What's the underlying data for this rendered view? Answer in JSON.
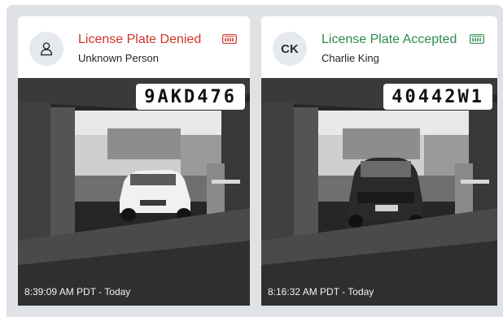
{
  "colors": {
    "denied": "#d0342c",
    "accepted": "#2e8b4e",
    "frame_background": "#dfe2e6",
    "avatar_background": "#e6e9ed"
  },
  "events": [
    {
      "status": "License Plate Denied",
      "status_type": "denied",
      "person": "Unknown Person",
      "avatar_icon": "person-outline-icon",
      "plate_icon": "license-plate-icon",
      "plate_number": "9AKD476",
      "timestamp": "8:39:09 AM PDT - Today"
    },
    {
      "status": "License Plate Accepted",
      "status_type": "accepted",
      "person": "Charlie King",
      "avatar_initials": "CK",
      "plate_icon": "license-plate-icon",
      "plate_number": "40442W1",
      "timestamp": "8:16:32 AM PDT - Today"
    }
  ]
}
